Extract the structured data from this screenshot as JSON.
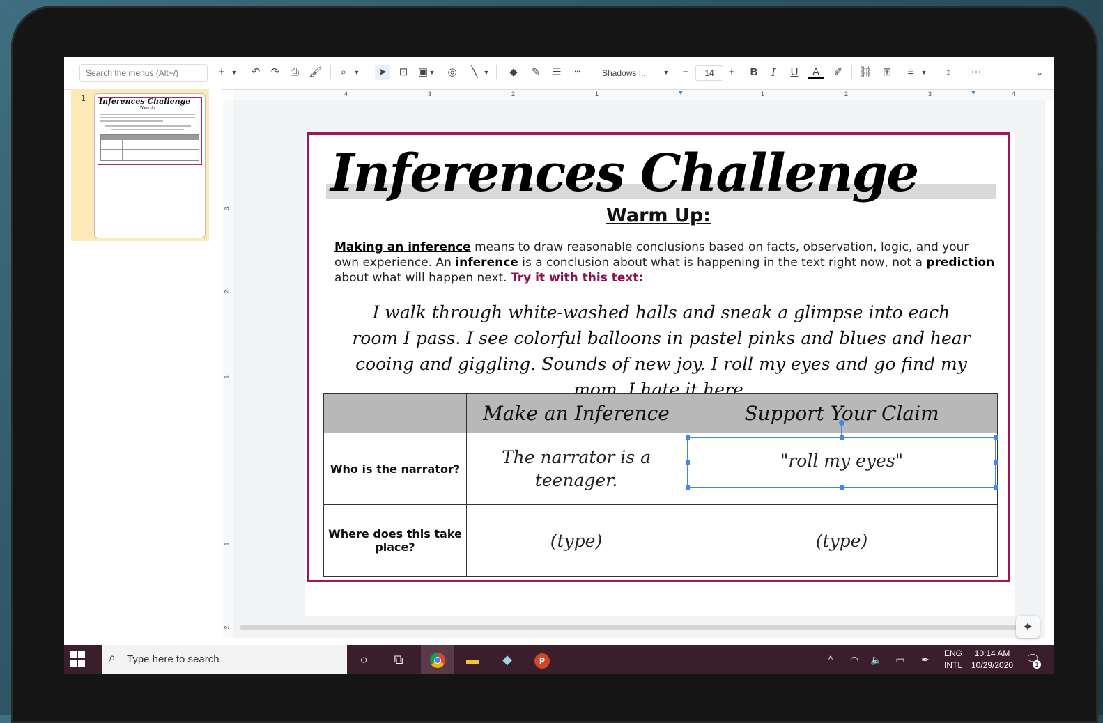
{
  "toolbar": {
    "search_placeholder": "Search the menus (Alt+/)",
    "font_name": "Shadows I...",
    "font_size": "14"
  },
  "ruler": {
    "h_labels": [
      "4",
      "3",
      "2",
      "1",
      "1",
      "2",
      "3",
      "4"
    ],
    "v_labels": [
      "3",
      "2",
      "1",
      "1",
      "2"
    ]
  },
  "filmstrip": {
    "slide_number": "1",
    "thumb_title": "Inferences Challenge",
    "thumb_sub": "Warm Up:"
  },
  "slide": {
    "title": "Inferences Challenge",
    "subtitle": "Warm Up:",
    "para_term1": "Making an inference",
    "para_text1": " means to draw reasonable conclusions based on facts, observation, logic, and your own experience. An ",
    "para_term2": "inference",
    "para_text2": " is a conclusion about what is happening in the text right now, not a ",
    "para_term3": "prediction",
    "para_text3": " about what will happen next. ",
    "para_try": "Try it with this text:",
    "passage": "I walk through white-washed halls and sneak a glimpse into each room I pass. I see colorful balloons in pastel pinks and blues and hear cooing and giggling. Sounds of new joy. I roll my eyes and go find my mom. I hate it here.",
    "table": {
      "headers": [
        "",
        "Make an Inference",
        "Support Your Claim"
      ],
      "rows": [
        {
          "label": "Who is the narrator?",
          "inference": "The narrator is a teenager.",
          "claim": "\"roll my eyes\""
        },
        {
          "label": "Where does this take place?",
          "inference": "(type)",
          "claim": "(type)"
        }
      ]
    }
  },
  "taskbar": {
    "search_text": "Type here to search",
    "lang_top": "ENG",
    "lang_bottom": "INTL",
    "time": "10:14 AM",
    "date": "10/29/2020",
    "notif_count": "1"
  },
  "colors": {
    "slide_border": "#a0145a",
    "taskbar": "#3b1e2c",
    "selection": "#4285f4",
    "filmstrip_selected": "#fde9b8"
  }
}
